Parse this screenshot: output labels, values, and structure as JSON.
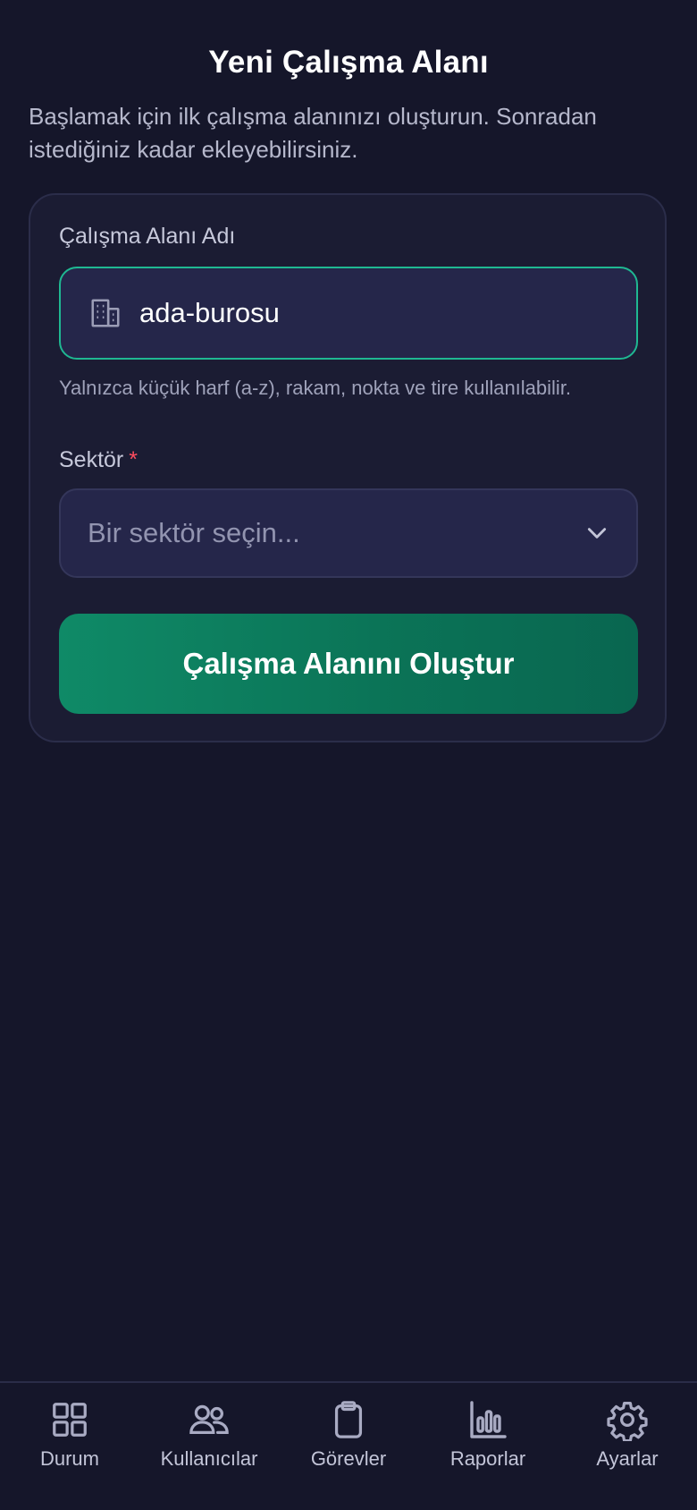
{
  "header": {
    "title": "Yeni Çalışma Alanı",
    "subtitle": "Başlamak için ilk çalışma alanınızı oluşturun. Sonradan istediğiniz kadar ekleyebilirsiniz."
  },
  "form": {
    "workspace_name": {
      "label": "Çalışma Alanı Adı",
      "value": "ada-burosu",
      "icon": "building-icon",
      "hint": "Yalnızca küçük harf (a-z), rakam, nokta ve tire kullanılabilir."
    },
    "sector": {
      "label": "Sektör",
      "required_mark": "*",
      "placeholder": "Bir sektör seçin...",
      "icon": "chevron-down-icon"
    },
    "submit_label": "Çalışma Alanını Oluştur"
  },
  "tabbar": {
    "items": [
      {
        "label": "Durum",
        "icon": "grid-icon"
      },
      {
        "label": "Kullanıcılar",
        "icon": "users-icon"
      },
      {
        "label": "Görevler",
        "icon": "clipboard-icon"
      },
      {
        "label": "Raporlar",
        "icon": "bar-chart-icon"
      },
      {
        "label": "Ayarlar",
        "icon": "gear-icon"
      }
    ]
  },
  "colors": {
    "background": "#15162a",
    "card": "#1b1c33",
    "accent": "#1fb892",
    "button": "#0b7457",
    "required": "#ff4d5f"
  }
}
